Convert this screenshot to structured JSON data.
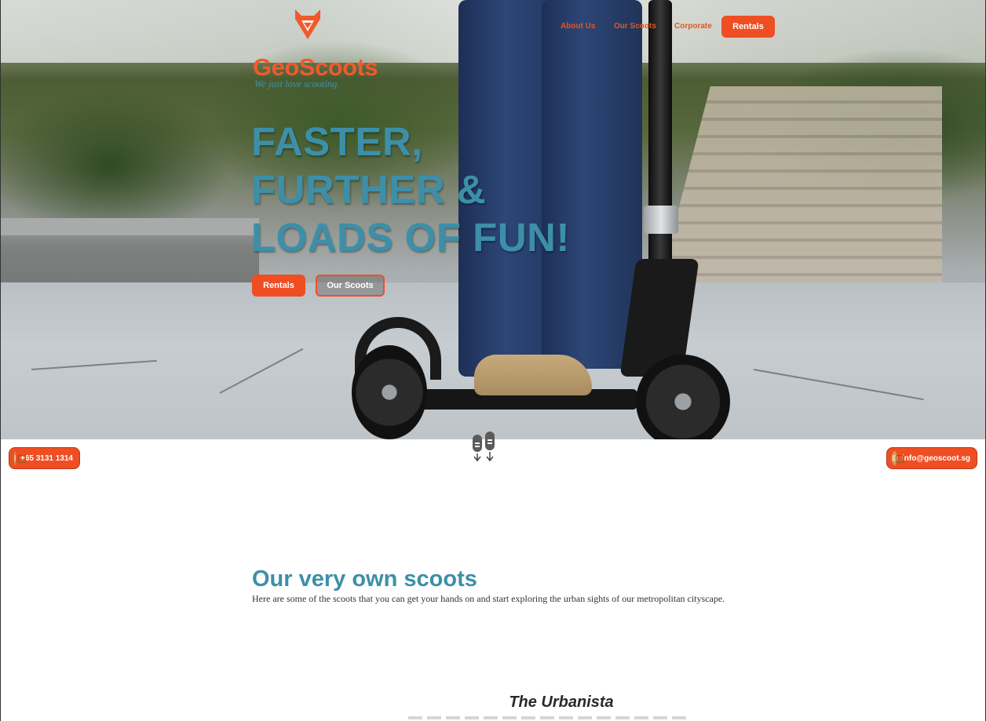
{
  "brand": {
    "name": "GeoScoots",
    "tagline": "We just love scooting."
  },
  "nav": {
    "links": [
      "About Us",
      "Our Scoots",
      "Corporate"
    ],
    "cta": "Rentals"
  },
  "hero": {
    "headline": [
      "FASTER,",
      "FURTHER &",
      "LOADS OF FUN!"
    ],
    "buttons": {
      "primary": "Rentals",
      "secondary": "Our Scoots"
    }
  },
  "contact": {
    "phone": "+65 3131 1314",
    "email": "info@geoscoot.sg"
  },
  "section": {
    "title": "Our very own scoots",
    "subtitle": "Here are some of the scoots that you can get your hands on and start exploring the urban sights of our metropolitan cityscape."
  },
  "product": {
    "title": "The Urbanista"
  },
  "colors": {
    "accent": "#ef4e23",
    "brand_blue": "#3d8fa8",
    "text": "#333333"
  },
  "icons": {
    "logo": "fox-head-icon",
    "phone": "phone-icon",
    "mail": "mail-icon",
    "scroll": "scroll-down-icon"
  }
}
